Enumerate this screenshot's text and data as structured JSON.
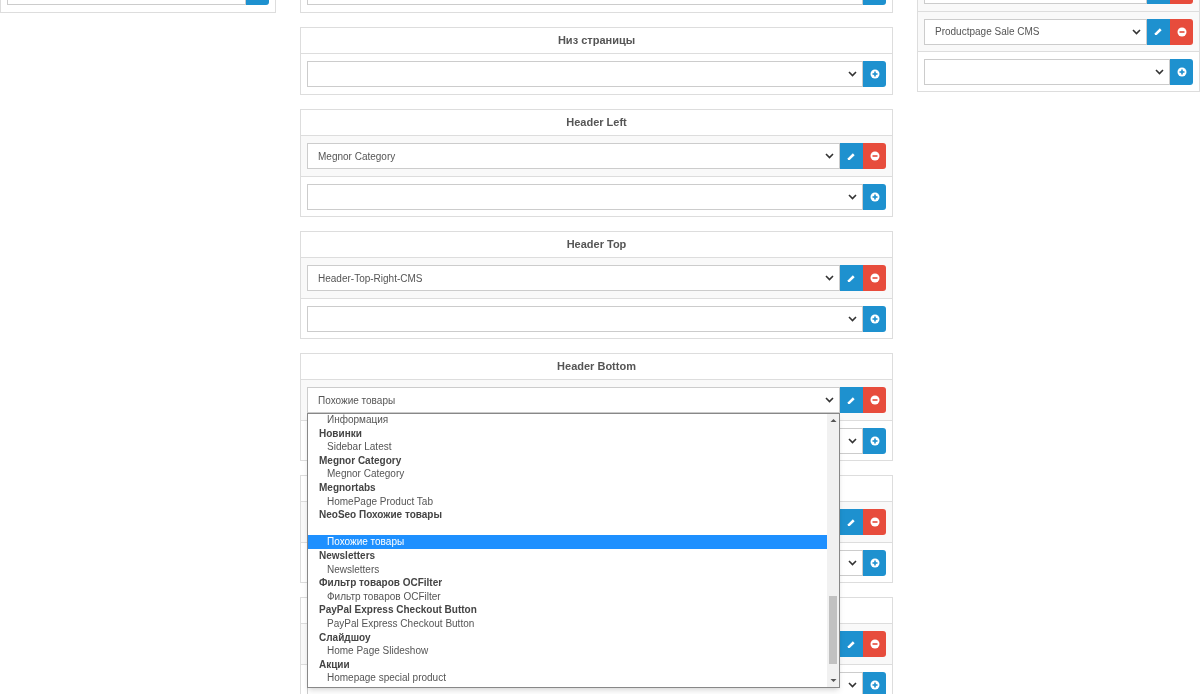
{
  "columns": [
    {
      "panels": [
        {
          "rows": [
            {
              "kind": "add"
            }
          ]
        }
      ]
    },
    {
      "panels": [
        {
          "rows": [
            {
              "kind": "add"
            }
          ]
        },
        {
          "title": "Низ страницы",
          "rows": [
            {
              "kind": "add"
            }
          ]
        },
        {
          "title": "Header Left",
          "rows": [
            {
              "kind": "edit",
              "value": "Megnor Category"
            },
            {
              "kind": "add"
            }
          ]
        },
        {
          "title": "Header Top",
          "rows": [
            {
              "kind": "edit",
              "value": "Header-Top-Right-CMS"
            },
            {
              "kind": "add"
            }
          ]
        },
        {
          "title": "Header Bottom",
          "rows": [
            {
              "kind": "edit",
              "value": "Похожие товары",
              "expanded": true,
              "options": [
                {
                  "kind": "option",
                  "label": "Информация",
                  "selected": false
                },
                {
                  "kind": "group",
                  "label": "Новинки"
                },
                {
                  "kind": "option",
                  "label": "Sidebar Latest",
                  "selected": false
                },
                {
                  "kind": "group",
                  "label": "Megnor Category"
                },
                {
                  "kind": "option",
                  "label": "Megnor Category",
                  "selected": false
                },
                {
                  "kind": "group",
                  "label": "Megnortabs"
                },
                {
                  "kind": "option",
                  "label": "HomePage Product Tab",
                  "selected": false
                },
                {
                  "kind": "group",
                  "label": "NeoSeo Похожие товары"
                },
                {
                  "kind": "blank"
                },
                {
                  "kind": "option",
                  "label": "Похожие товары",
                  "selected": true
                },
                {
                  "kind": "group",
                  "label": "Newsletters"
                },
                {
                  "kind": "option",
                  "label": "Newsletters",
                  "selected": false
                },
                {
                  "kind": "group",
                  "label": "Фильтр товаров OCFilter"
                },
                {
                  "kind": "option",
                  "label": "Фильтр товаров OCFilter",
                  "selected": false
                },
                {
                  "kind": "group",
                  "label": "PayPal Express Checkout Button"
                },
                {
                  "kind": "option",
                  "label": "PayPal Express Checkout Button",
                  "selected": false
                },
                {
                  "kind": "group",
                  "label": "Слайдшоу"
                },
                {
                  "kind": "option",
                  "label": "Home Page Slideshow",
                  "selected": false
                },
                {
                  "kind": "group",
                  "label": "Акции"
                },
                {
                  "kind": "option",
                  "label": "Homepage special product",
                  "selected": false
                }
              ]
            },
            {
              "kind": "add"
            }
          ]
        },
        {
          "rows": [
            {
              "kind": "edit"
            },
            {
              "kind": "add"
            }
          ]
        },
        {
          "rows": [
            {
              "kind": "edit"
            },
            {
              "kind": "add"
            }
          ]
        }
      ]
    },
    {
      "panels": [
        {
          "rows": [
            {
              "kind": "edit"
            },
            {
              "kind": "edit",
              "value": "Productpage Sale CMS"
            },
            {
              "kind": "add"
            }
          ]
        }
      ]
    }
  ]
}
